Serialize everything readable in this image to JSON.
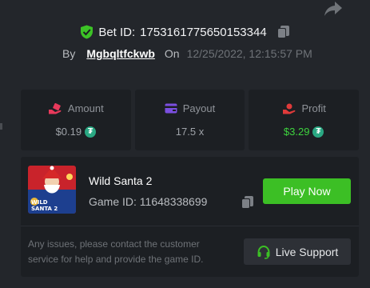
{
  "header": {
    "bet_label": "Bet ID:",
    "bet_id": "1753161775650153344",
    "by_label": "By",
    "username": "Mgbqltfckwb",
    "on_label": "On",
    "date": "12/25/2022, 12:15:57 PM"
  },
  "stats": {
    "amount": {
      "label": "Amount",
      "value": "$0.19",
      "currency_icon": "tether-icon"
    },
    "payout": {
      "label": "Payout",
      "value": "17.5 x"
    },
    "profit": {
      "label": "Profit",
      "value": "$3.29",
      "currency_icon": "tether-icon"
    }
  },
  "game": {
    "title": "Wild Santa 2",
    "id_label": "Game ID:",
    "id": "11648338699",
    "thumb_text_line1": "WILD",
    "thumb_text_line2": "SANTA 2",
    "play_button": "Play Now"
  },
  "support": {
    "help_text": "Any issues, please contact the customer service for help and provide the game ID.",
    "live_support_button": "Live Support"
  },
  "colors": {
    "background": "#23262b",
    "card": "#1c1f23",
    "accent_green": "#3cbf25",
    "profit_green": "#3ed33e",
    "amount_pink": "#e8395b",
    "payout_purple": "#7b4fe0",
    "profit_red": "#e03a3a",
    "tether": "#2aa883"
  }
}
